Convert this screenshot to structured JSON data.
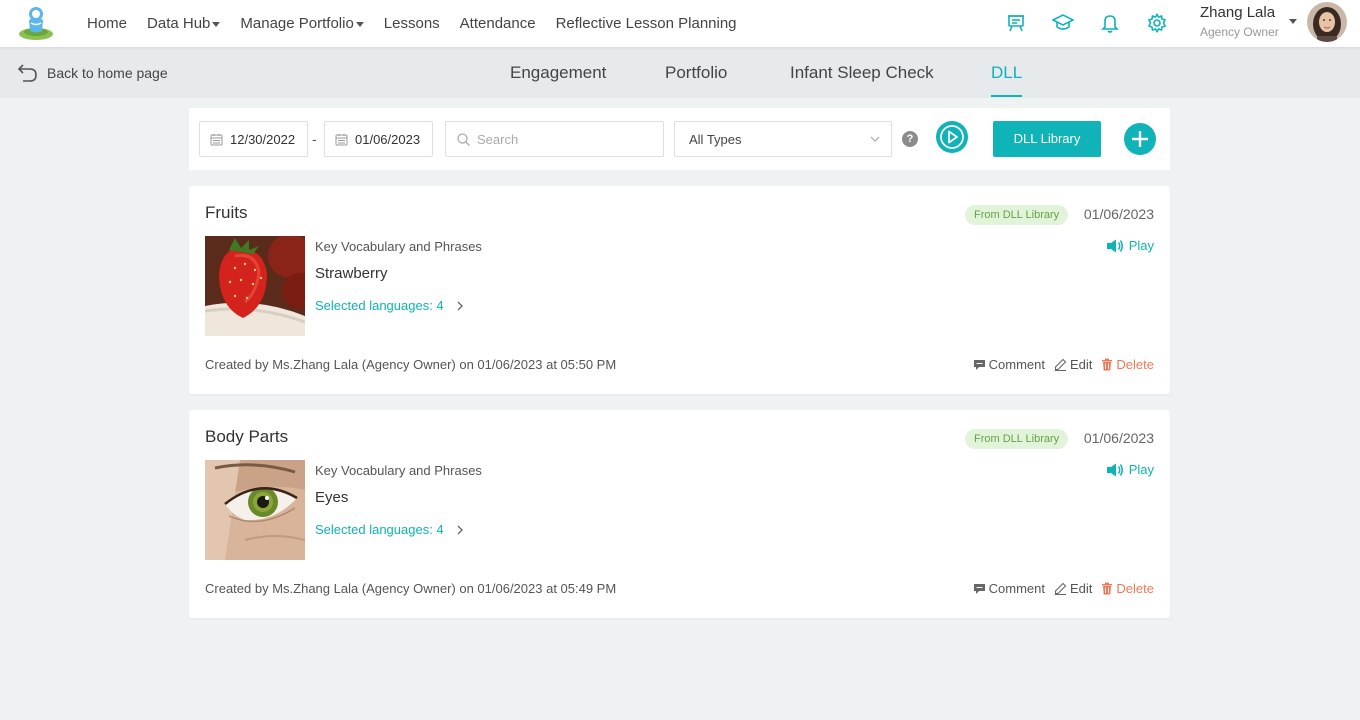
{
  "nav": {
    "items": [
      {
        "label": "Home",
        "dropdown": false
      },
      {
        "label": "Data Hub",
        "dropdown": true
      },
      {
        "label": "Manage Portfolio",
        "dropdown": true
      },
      {
        "label": "Lessons",
        "dropdown": false
      },
      {
        "label": "Attendance",
        "dropdown": false
      },
      {
        "label": "Reflective Lesson Planning",
        "dropdown": false
      }
    ],
    "icons": [
      "presentation-board-icon",
      "graduation-cap-icon",
      "bell-icon",
      "gear-icon"
    ],
    "user": {
      "name": "Zhang Lala",
      "role": "Agency Owner"
    }
  },
  "subnav": {
    "back_label": "Back to home page",
    "tabs": [
      "Engagement",
      "Portfolio",
      "Infant Sleep Check",
      "DLL"
    ],
    "active_tab": "DLL"
  },
  "filters": {
    "start_date": "12/30/2022",
    "end_date": "01/06/2023",
    "separator": "-",
    "search_placeholder": "Search",
    "type_selected": "All Types",
    "help_symbol": "?",
    "library_label": "DLL Library"
  },
  "cards": [
    {
      "title": "Fruits",
      "badge": "From DLL Library",
      "date": "01/06/2023",
      "section_label": "Key Vocabulary and Phrases",
      "word": "Strawberry",
      "languages": "Selected languages: 4",
      "play_label": "Play",
      "created": "Created by Ms.Zhang Lala (Agency Owner) on 01/06/2023 at 05:50 PM",
      "comment_label": "Comment",
      "edit_label": "Edit",
      "delete_label": "Delete",
      "image": "strawberry-photo"
    },
    {
      "title": "Body Parts",
      "badge": "From DLL Library",
      "date": "01/06/2023",
      "section_label": "Key Vocabulary and Phrases",
      "word": "Eyes",
      "languages": "Selected languages: 4",
      "play_label": "Play",
      "created": "Created by Ms.Zhang Lala (Agency Owner) on 01/06/2023 at 05:49 PM",
      "comment_label": "Comment",
      "edit_label": "Edit",
      "delete_label": "Delete",
      "image": "eye-photo"
    }
  ],
  "colors": {
    "accent": "#10b3b7",
    "badge_bg": "#e1f3d8",
    "badge_text": "#67a04c",
    "delete": "#f0785a",
    "page_bg": "#eff2f3"
  }
}
